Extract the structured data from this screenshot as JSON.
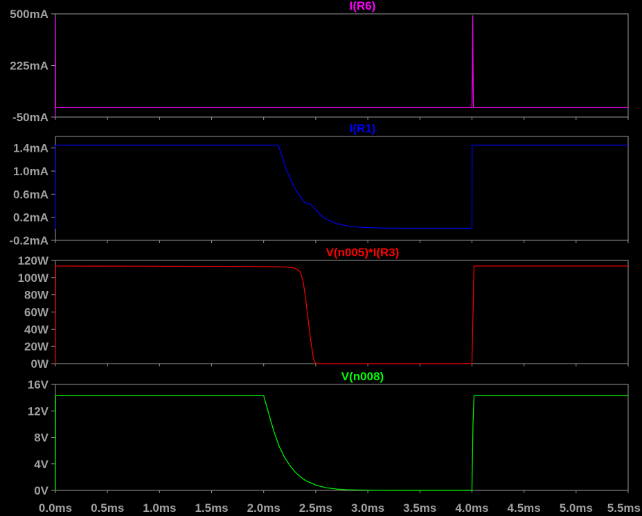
{
  "x_axis": {
    "unit": "ms",
    "ticks": [
      "0.0ms",
      "0.5ms",
      "1.0ms",
      "1.5ms",
      "2.0ms",
      "2.5ms",
      "3.0ms",
      "3.5ms",
      "4.0ms",
      "4.5ms",
      "5.0ms",
      "5.5ms"
    ]
  },
  "chart_data": [
    {
      "type": "line",
      "title": "I(R6)",
      "xlim": [
        0,
        5.5
      ],
      "ylim": [
        -50,
        500
      ],
      "yticks": [
        500,
        225,
        -50
      ],
      "ytick_labels": [
        "500mA",
        "225mA",
        "-50mA"
      ],
      "series": [
        {
          "name": "I(R6)",
          "color": "#ff00ff",
          "x": [
            0,
            0.001,
            0.003,
            0.01,
            4.0,
            4.005,
            4.008,
            4.011,
            4.014,
            4.02,
            5.5
          ],
          "y": [
            -50,
            480,
            0,
            0,
            0,
            210,
            490,
            180,
            0,
            0,
            0
          ]
        }
      ]
    },
    {
      "type": "line",
      "title": "I(R1)",
      "xlim": [
        0,
        5.5
      ],
      "ylim": [
        -0.2,
        1.6
      ],
      "yticks": [
        1.4,
        1.0,
        0.6,
        0.2,
        -0.2
      ],
      "ytick_labels": [
        "1.4mA",
        "1.0mA",
        "0.6mA",
        "0.2mA",
        "-0.2mA"
      ],
      "series": [
        {
          "name": "I(R1)",
          "color": "#0000ff",
          "x": [
            0,
            0.002,
            0.02,
            2.14,
            2.18,
            2.22,
            2.26,
            2.3,
            2.35,
            2.4,
            2.45,
            2.5,
            2.55,
            2.6,
            2.7,
            2.8,
            2.9,
            3.0,
            3.2,
            3.5,
            4.0,
            4.002,
            5.5
          ],
          "y": [
            0.0,
            1.45,
            1.45,
            1.45,
            1.24,
            1.02,
            0.85,
            0.7,
            0.56,
            0.44,
            0.43,
            0.33,
            0.23,
            0.17,
            0.09,
            0.05,
            0.03,
            0.02,
            0.01,
            0.01,
            0.01,
            1.45,
            1.45
          ]
        }
      ]
    },
    {
      "type": "line",
      "title": "V(n005)*I(R3)",
      "xlim": [
        0,
        5.5
      ],
      "ylim": [
        0,
        120
      ],
      "yticks": [
        120,
        100,
        80,
        60,
        40,
        20,
        0
      ],
      "ytick_labels": [
        "120W",
        "100W",
        "80W",
        "60W",
        "40W",
        "20W",
        "0W"
      ],
      "series": [
        {
          "name": "V(n005)*I(R3)",
          "color": "#ff0000",
          "x": [
            0,
            0.002,
            0.02,
            2.0,
            2.2,
            2.3,
            2.35,
            2.38,
            2.4,
            2.42,
            2.44,
            2.46,
            2.48,
            2.5,
            2.55,
            4.0,
            4.02,
            5.5
          ],
          "y": [
            0,
            113.5,
            113.5,
            113,
            112.5,
            111,
            107,
            95,
            78,
            58,
            38,
            20,
            5,
            0,
            0,
            0,
            113.5,
            113.5
          ]
        }
      ]
    },
    {
      "type": "line",
      "title": "V(n008)",
      "xlim": [
        0,
        5.5
      ],
      "ylim": [
        0,
        16
      ],
      "yticks": [
        16,
        12,
        8,
        4,
        0
      ],
      "ytick_labels": [
        "16V",
        "12V",
        "8V",
        "4V",
        "0V"
      ],
      "series": [
        {
          "name": "V(n008)",
          "color": "#00ff00",
          "x": [
            0,
            0.002,
            0.02,
            2.0,
            2.05,
            2.1,
            2.15,
            2.2,
            2.25,
            2.3,
            2.35,
            2.4,
            2.5,
            2.6,
            2.7,
            2.8,
            3.0,
            3.2,
            4.0,
            4.005,
            4.01,
            4.02,
            5.5
          ],
          "y": [
            0,
            14.3,
            14.3,
            14.3,
            11.5,
            8.8,
            6.6,
            5.0,
            3.8,
            2.8,
            2.1,
            1.5,
            0.8,
            0.4,
            0.2,
            0.1,
            0.03,
            0.0,
            0.0,
            5.0,
            10.0,
            14.3,
            14.3
          ]
        }
      ]
    }
  ]
}
